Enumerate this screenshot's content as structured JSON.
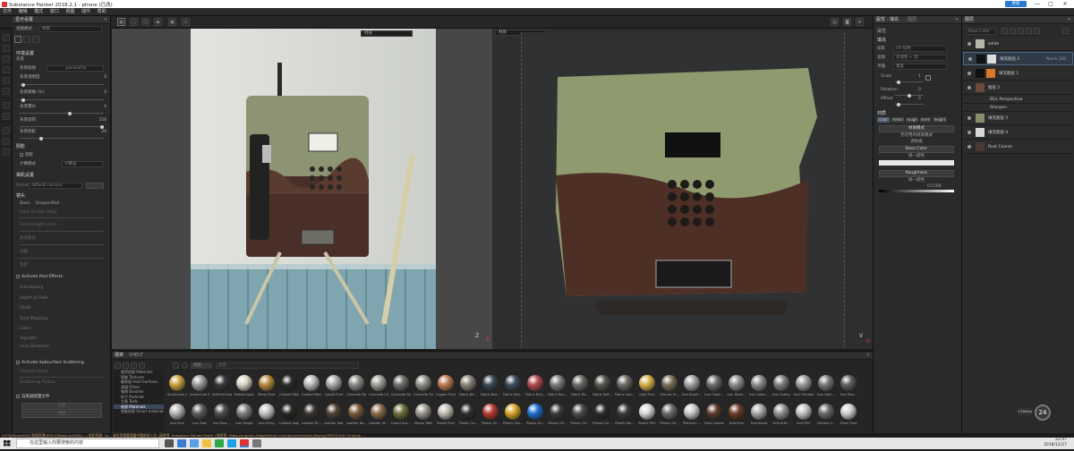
{
  "title": "Substance Painter 2018.2.1 - phone (已改)",
  "window_controls": {
    "minimize": "—",
    "maximize": "□",
    "close": "✕",
    "update": "更新"
  },
  "menu": [
    "文件",
    "编辑",
    "模式",
    "窗口",
    "视图",
    "插件",
    "帮助"
  ],
  "left_panel": {
    "title": "显示设置",
    "tabs": {
      "mode_label": "视图模式",
      "mode_value": "材质"
    },
    "env_section": "环境设置",
    "env_label": "背景",
    "env_map_label": "背景贴图",
    "env_map_value": "panorama",
    "rows": [
      {
        "label": "背景透明度",
        "value": "0"
      },
      {
        "label": "背景模糊 (%)",
        "value": "0"
      },
      {
        "label": "背景曝光",
        "value": "0"
      },
      {
        "label": "背景旋转",
        "value": "358"
      },
      {
        "label": "背景阴影",
        "value": "20"
      }
    ],
    "shadow_section": "阴影",
    "shadow_check": "阴影",
    "shadow_mode_label": "计算模式",
    "shadow_mode_value": "计算设",
    "camera_section": "相机设置",
    "preset_label": "Preset",
    "preset_value": "default camera",
    "camera_sub": "镜头",
    "camera_rows": [
      {
        "label": "Basis",
        "value": "Unspecified"
      },
      {
        "label": "Field of view (deg)",
        "value": ""
      },
      {
        "label": "Focal length (mm)",
        "value": ""
      },
      {
        "label": "焦点距离",
        "value": ""
      },
      {
        "label": "光圈",
        "value": ""
      },
      {
        "label": "焦距",
        "value": ""
      }
    ],
    "effects": [
      "Activate Post Effects",
      "Antialiasing",
      "Depth of Field",
      "SSAO",
      "Tone Mapping",
      "Glare",
      "Vignette",
      "Lens Distortion"
    ],
    "subsurface": "Activate Subsurface Scattering",
    "sss_row1": "Sample Count",
    "sss_row2": "Scattering Radius",
    "misc_label": "渲染器配置文件",
    "misc_btn1": "全部",
    "misc_btn2": "材质"
  },
  "viewport2d": {
    "dropdown": "材质",
    "axis_z": "Z",
    "axis_x": "X"
  },
  "viewport3d": {
    "dropdown": "材质",
    "axis_u": "U",
    "axis_v": "V"
  },
  "properties": {
    "title": "属性 - 填充",
    "tab2": "图层",
    "section1": "填充",
    "proj_label": "投影",
    "proj_value": "UV 投射",
    "wrap_label": "滤镜",
    "wrap_value": "双线性 + 高",
    "tile_label": "平铺",
    "tile_value": "重复",
    "scale_label": "Scale",
    "scale_value": "1",
    "rot_label": "Rotation",
    "rot_value": "0",
    "offset_label": "Offset",
    "offset_value": "0",
    "channels_section": "材质",
    "channels": [
      "color",
      "metal",
      "rough",
      "norm",
      "height"
    ],
    "mode_label": "材质模式",
    "mode_value": "无可用的材质模式",
    "base_color_title": "Base Color",
    "base_color_value": "统一颜色",
    "roughness_title": "Roughness",
    "roughness_value": "统一颜色",
    "roughness_num": "0.5769",
    "props_top": "属性",
    "palette": "调色板"
  },
  "layers": {
    "title": "图层",
    "mode": "Base Color",
    "items": [
      {
        "name": "white",
        "sub": ""
      },
      {
        "name": "填充图层 2",
        "sub": "Norm 100"
      },
      {
        "name": "填充图层 1",
        "sub": ""
      },
      {
        "name": "图层 2",
        "sub": ""
      },
      {
        "name": "BGL Perspective",
        "sub": ""
      },
      {
        "name": "Sharpen",
        "sub": ""
      },
      {
        "name": "填充图层 5",
        "sub": ""
      },
      {
        "name": "填充图层 4",
        "sub": ""
      },
      {
        "name": "Rust Coarse",
        "sub": ""
      }
    ]
  },
  "shelf": {
    "title": "展架",
    "tab": "SHELF",
    "filter": "材质",
    "search_placeholder": "搜索",
    "categories": [
      "程序纹理 Materials",
      "智能 Textures",
      "硬表面 Hard Surfaces",
      "滤镜 Filters",
      "笔刷 Brushes",
      "粒子 Particles",
      "工具 Tools",
      "材质 Materials",
      "智能材质 Smart materials"
    ],
    "selected_category": 7,
    "materials": [
      {
        "name": "Aluminium Am...",
        "color": "#c9a23e"
      },
      {
        "name": "Aluminium Bru...",
        "color": "#9a9a98"
      },
      {
        "name": "Artificial Lea...",
        "color": "#3a3a3a"
      },
      {
        "name": "Baked Light...",
        "color": "#d8d2c6"
      },
      {
        "name": "Brass Pure",
        "color": "#b98a3e"
      },
      {
        "name": "Carbon Fiber",
        "color": "#2a2a2a"
      },
      {
        "name": "Coated Metal",
        "color": "#b9b9b9"
      },
      {
        "name": "Cobalt Pure",
        "color": "#a7a9ad"
      },
      {
        "name": "Concrete Bare",
        "color": "#8b8a86"
      },
      {
        "name": "Concrete Clean",
        "color": "#a19e97"
      },
      {
        "name": "Concrete Dirty",
        "color": "#6f6d68"
      },
      {
        "name": "Concrete Sm...",
        "color": "#918e88"
      },
      {
        "name": "Copper Pure",
        "color": "#c07a55"
      },
      {
        "name": "Fabric Ba...",
        "color": "#8a8379"
      },
      {
        "name": "Fabric Bas...",
        "color": "#3b4954"
      },
      {
        "name": "Fabric Den...",
        "color": "#3f4b5c"
      },
      {
        "name": "Fabric Knit...",
        "color": "#b34b4f"
      },
      {
        "name": "Fabric Rou...",
        "color": "#7c7a76"
      },
      {
        "name": "Fabric Ro...",
        "color": "#6b6a66"
      },
      {
        "name": "Fabric Soft...",
        "color": "#585650"
      },
      {
        "name": "Fabric Sub...",
        "color": "#6d6a64"
      },
      {
        "name": "Gold Pure",
        "color": "#d7b24a"
      },
      {
        "name": "Ground Gr...",
        "color": "#7b6f58"
      },
      {
        "name": "Iron Brush...",
        "color": "#a2a2a4"
      },
      {
        "name": "Iron Chain...",
        "color": "#6b6b6d"
      },
      {
        "name": "Iron Diam...",
        "color": "#8b8b8d"
      },
      {
        "name": "Iron Galva...",
        "color": "#8a8c8e"
      },
      {
        "name": "Iron Grainy",
        "color": "#7d7e80"
      },
      {
        "name": "Iron Grinded",
        "color": "#9a9b9d"
      },
      {
        "name": "Iron Ham...",
        "color": "#77787a"
      },
      {
        "name": "Iron Pow...",
        "color": "#5e5f61"
      },
      {
        "name": "Iron Pure",
        "color": "#b2b3b5"
      },
      {
        "name": "Iron Raw",
        "color": "#5c5c5c"
      },
      {
        "name": "Iron Raw ...",
        "color": "#4a4a4a"
      },
      {
        "name": "Iron Rough",
        "color": "#808080"
      },
      {
        "name": "Iron Shiny",
        "color": "#c2c2c4"
      },
      {
        "name": "Leather bag",
        "color": "#2a2622"
      },
      {
        "name": "Leather Bl...",
        "color": "#3a3431"
      },
      {
        "name": "Leather Wal...",
        "color": "#4d4035"
      },
      {
        "name": "Leather Bo...",
        "color": "#7a5a3a"
      },
      {
        "name": "Leather Sk...",
        "color": "#8a6a4a"
      },
      {
        "name": "Lizard Sca...",
        "color": "#6c6e3c"
      },
      {
        "name": "Mortar Wall",
        "color": "#9c968c"
      },
      {
        "name": "Nickel Pure",
        "color": "#bfbcb2"
      },
      {
        "name": "Plastic Ca...",
        "color": "#2e2e2e"
      },
      {
        "name": "Plastic Gl...",
        "color": "#b73a31"
      },
      {
        "name": "Plastic Gla...",
        "color": "#d8a52a"
      },
      {
        "name": "Plastic Gr...",
        "color": "#1f6fd1"
      },
      {
        "name": "Plastic Gri...",
        "color": "#3a3a3a"
      },
      {
        "name": "Plastic Gri...",
        "color": "#4b4b4b"
      },
      {
        "name": "Plastic Gri...",
        "color": "#2b2b2b"
      },
      {
        "name": "Plastic Ma...",
        "color": "#3a3a3a"
      },
      {
        "name": "Plastic PVC",
        "color": "#d6d6d6"
      },
      {
        "name": "Plastic Gri...",
        "color": "#6a6a6a"
      },
      {
        "name": "Platinum ...",
        "color": "#c7c7c9"
      },
      {
        "name": "Rust Coarse",
        "color": "#5a3a2a"
      },
      {
        "name": "Rust fine",
        "color": "#6b3b26"
      },
      {
        "name": "Scarfmoot",
        "color": "#a8a8aa"
      },
      {
        "name": "Scifi Artif...",
        "color": "#8f9091"
      },
      {
        "name": "Scifi PVC",
        "color": "#c3c3c3"
      },
      {
        "name": "Silicone C...",
        "color": "#6a6a6a"
      },
      {
        "name": "Silver Pure",
        "color": "#d0d0d2"
      }
    ]
  },
  "status_text": "[VFS][SharedLib] 贴图资源(SHELF|ResourceUID|s...) 组织资源: 1s... 请在资源管理器中重新导入它 (请使用: Substance Painter-Shelf) | 搜索框: https://support.allegorithmic.com/documentation/display/SPDOC/UV+Unwrap ...",
  "perf": {
    "fps": "24",
    "mem": "+190ms"
  },
  "taskbar": {
    "search": "在这里输入你要搜索的内容",
    "time": "22:47",
    "date": "2018/12/27"
  }
}
